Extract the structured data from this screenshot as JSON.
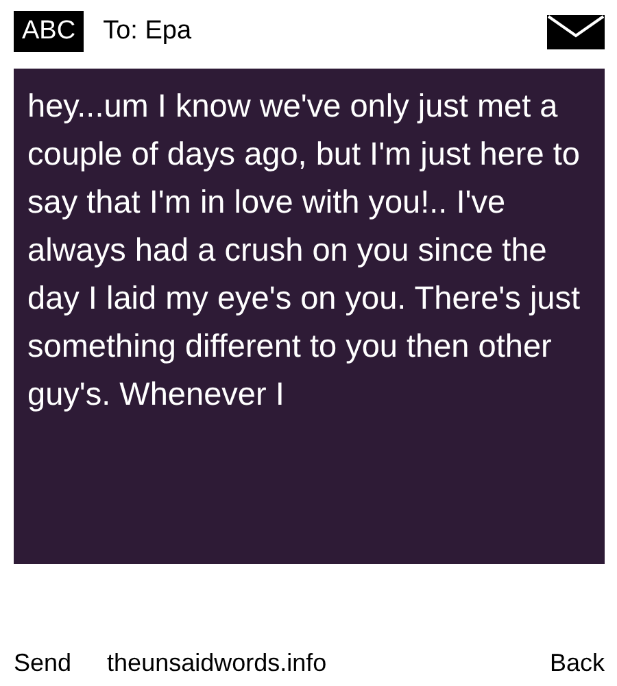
{
  "header": {
    "mode": "ABC",
    "recipient": "To: Epa"
  },
  "message": {
    "text": "hey...um I know we've only just met a couple of days ago, but I'm just here to say that I'm in love with you!.. I've always had a crush on you since the day I laid my eye's on you. There's just something different to you then other guy's. Whenever I"
  },
  "softkeys": {
    "left": "Send",
    "center": "theunsaidwords.info",
    "right": "Back"
  }
}
